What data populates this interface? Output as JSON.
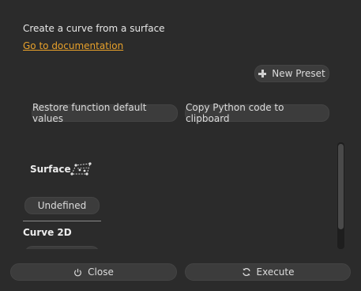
{
  "header": {
    "description": "Create a curve from a surface",
    "doc_link": "Go to documentation"
  },
  "toolbar": {
    "new_preset": "New Preset",
    "restore_defaults": "Restore function default values",
    "copy_python": "Copy Python code to clipboard"
  },
  "parameters": {
    "surface": {
      "label": "Surface",
      "value": "Undefined",
      "icon": "surface-icon"
    },
    "curve2d": {
      "label": "Curve 2D"
    }
  },
  "footer": {
    "close": "Close",
    "execute": "Execute"
  },
  "colors": {
    "background": "#2b2b2b",
    "button": "#3c3c3c",
    "link": "#e8a12b"
  }
}
